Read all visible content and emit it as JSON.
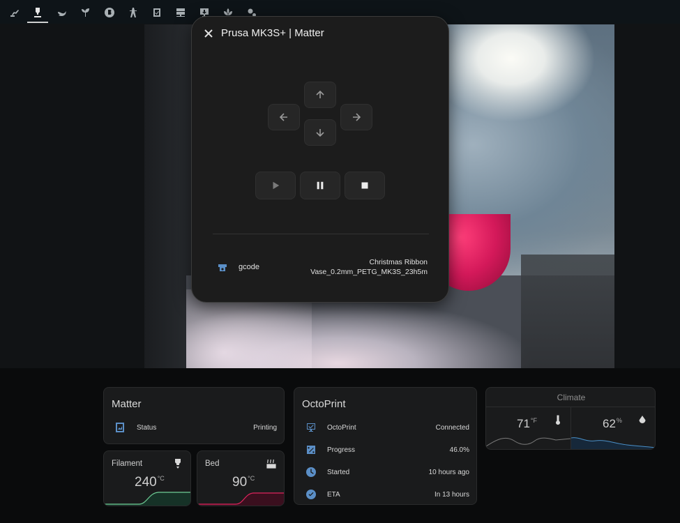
{
  "nav": {
    "tabs": [
      {
        "icon": "robot-arm-icon",
        "active": false
      },
      {
        "icon": "printer-3d-nozzle-icon",
        "active": true
      },
      {
        "icon": "bird-icon",
        "active": false
      },
      {
        "icon": "sprout-icon",
        "active": false
      },
      {
        "icon": "bitcoin-icon",
        "active": false
      },
      {
        "icon": "transmission-tower-icon",
        "active": false
      },
      {
        "icon": "clipboard-check-icon",
        "active": false
      },
      {
        "icon": "server-network-icon",
        "active": false
      },
      {
        "icon": "monitor-download-icon",
        "active": false
      },
      {
        "icon": "spa-icon",
        "active": false
      },
      {
        "icon": "cogs-icon",
        "active": false
      }
    ]
  },
  "dialog": {
    "title": "Prusa MK3S+ | Matter",
    "file_label": "gcode",
    "file_value": "Christmas Ribbon Vase_0.2mm_PETG_MK3S_23h5m"
  },
  "matter_card": {
    "title": "Matter",
    "status_label": "Status",
    "status_value": "Printing"
  },
  "octoprint_card": {
    "title": "OctoPrint",
    "rows": [
      {
        "label": "OctoPrint",
        "value": "Connected",
        "icon": "monitor-check-icon"
      },
      {
        "label": "Progress",
        "value": "46.0%",
        "icon": "percent-box-icon"
      },
      {
        "label": "Started",
        "value": "10 hours ago",
        "icon": "clock-icon"
      },
      {
        "label": "ETA",
        "value": "In 13 hours",
        "icon": "check-circle-icon"
      }
    ]
  },
  "filament_card": {
    "title": "Filament",
    "value": "240",
    "unit": "°C",
    "color": "#6fcf97"
  },
  "bed_card": {
    "title": "Bed",
    "value": "90",
    "unit": "°C",
    "color": "#e0245e"
  },
  "climate_card": {
    "title": "Climate",
    "temperature": {
      "value": "71",
      "unit": "°F"
    },
    "humidity": {
      "value": "62",
      "unit": "%"
    },
    "line_color": "#4a90c8"
  }
}
